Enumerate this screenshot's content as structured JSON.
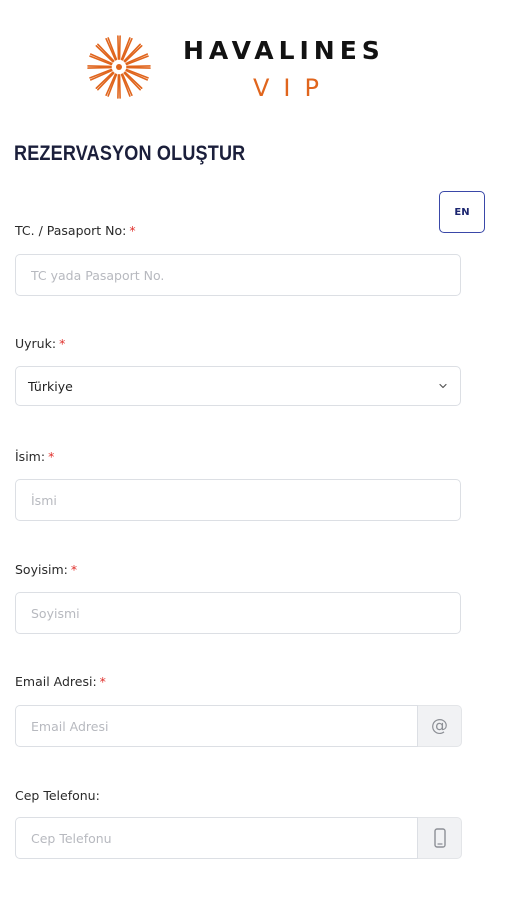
{
  "brand": {
    "name": "HAVALINES",
    "sub": "VIP",
    "mark_color": "#e0651d"
  },
  "page": {
    "title": "REZERVASYON OLUŞTUR"
  },
  "lang_button": {
    "label": "EN"
  },
  "required_marker": "*",
  "form": {
    "id_number": {
      "label": "TC. / Pasaport No:",
      "placeholder": "TC yada Pasaport No."
    },
    "nationality": {
      "label": "Uyruk:",
      "value": "Türkiye"
    },
    "first_name": {
      "label": "İsim:",
      "placeholder": "İsmi"
    },
    "last_name": {
      "label": "Soyisim:",
      "placeholder": "Soyismi"
    },
    "email": {
      "label": "Email Adresi:",
      "placeholder": "Email Adresi",
      "addon_icon": "at-icon",
      "addon_glyph": "@"
    },
    "phone": {
      "label": "Cep Telefonu:",
      "placeholder": "Cep Telefonu",
      "addon_icon": "mobile-phone-icon"
    }
  },
  "colors": {
    "accent": "#e0651d",
    "title": "#1b1f3b",
    "required": "#e0302c",
    "lang_border": "#3a48a8"
  }
}
